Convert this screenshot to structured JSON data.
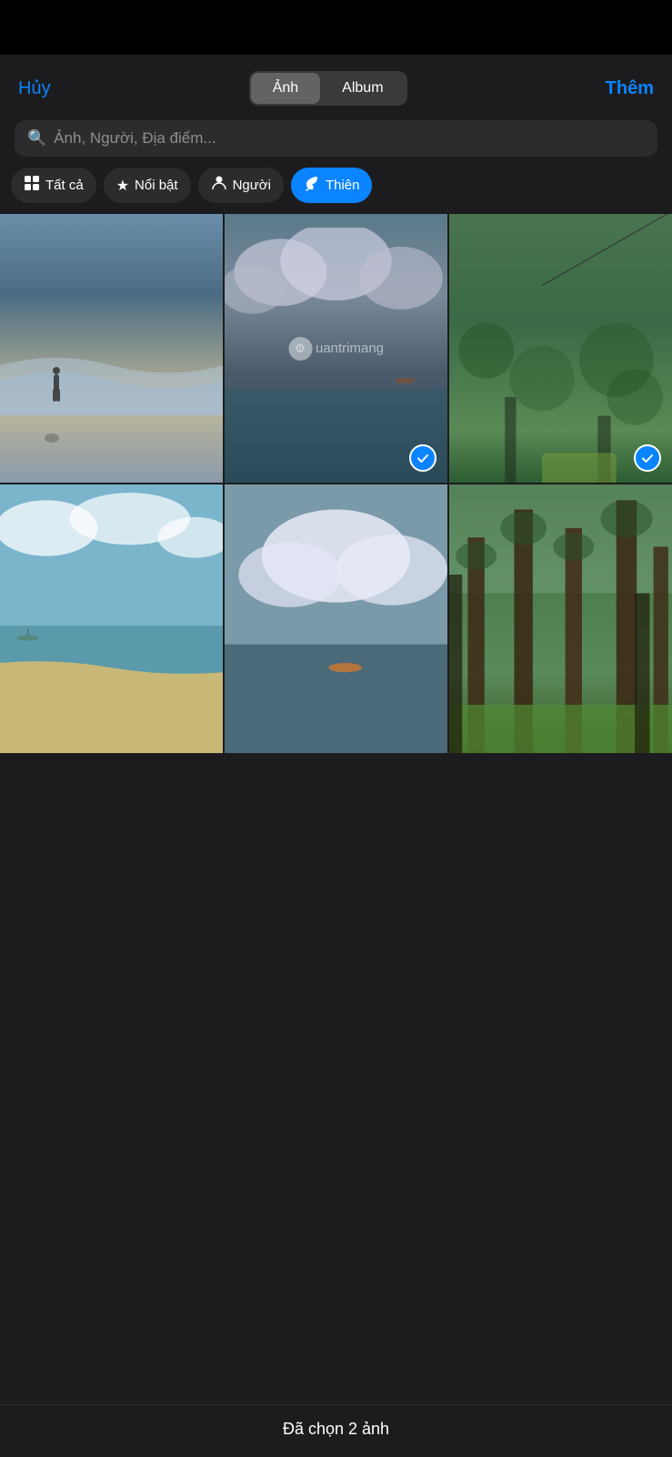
{
  "topBar": {
    "cancelLabel": "Hủy",
    "addLabel": "Thêm"
  },
  "segmentControl": {
    "photoLabel": "Ảnh",
    "albumLabel": "Album",
    "activeTab": "photo"
  },
  "search": {
    "placeholder": "Ảnh, Người, Địa điểm..."
  },
  "filters": [
    {
      "id": "all",
      "icon": "grid",
      "label": "Tất cả",
      "active": false
    },
    {
      "id": "featured",
      "icon": "star",
      "label": "Nổi bật",
      "active": false
    },
    {
      "id": "people",
      "icon": "person",
      "label": "Người",
      "active": false
    },
    {
      "id": "nature",
      "icon": "leaf",
      "label": "Thiên",
      "active": true
    }
  ],
  "photos": {
    "row1": [
      {
        "id": "p1",
        "selected": false,
        "hasWatermark": false
      },
      {
        "id": "p2",
        "selected": true,
        "hasWatermark": true
      },
      {
        "id": "p3",
        "selected": true,
        "hasWatermark": false
      }
    ],
    "row2": [
      {
        "id": "p4",
        "selected": false,
        "hasWatermark": false
      },
      {
        "id": "p5",
        "selected": false,
        "hasWatermark": false
      },
      {
        "id": "p6",
        "selected": false,
        "hasWatermark": false
      }
    ]
  },
  "watermark": {
    "text": "uantrimang"
  },
  "bottomBar": {
    "label": "Đã chọn 2 ảnh"
  }
}
